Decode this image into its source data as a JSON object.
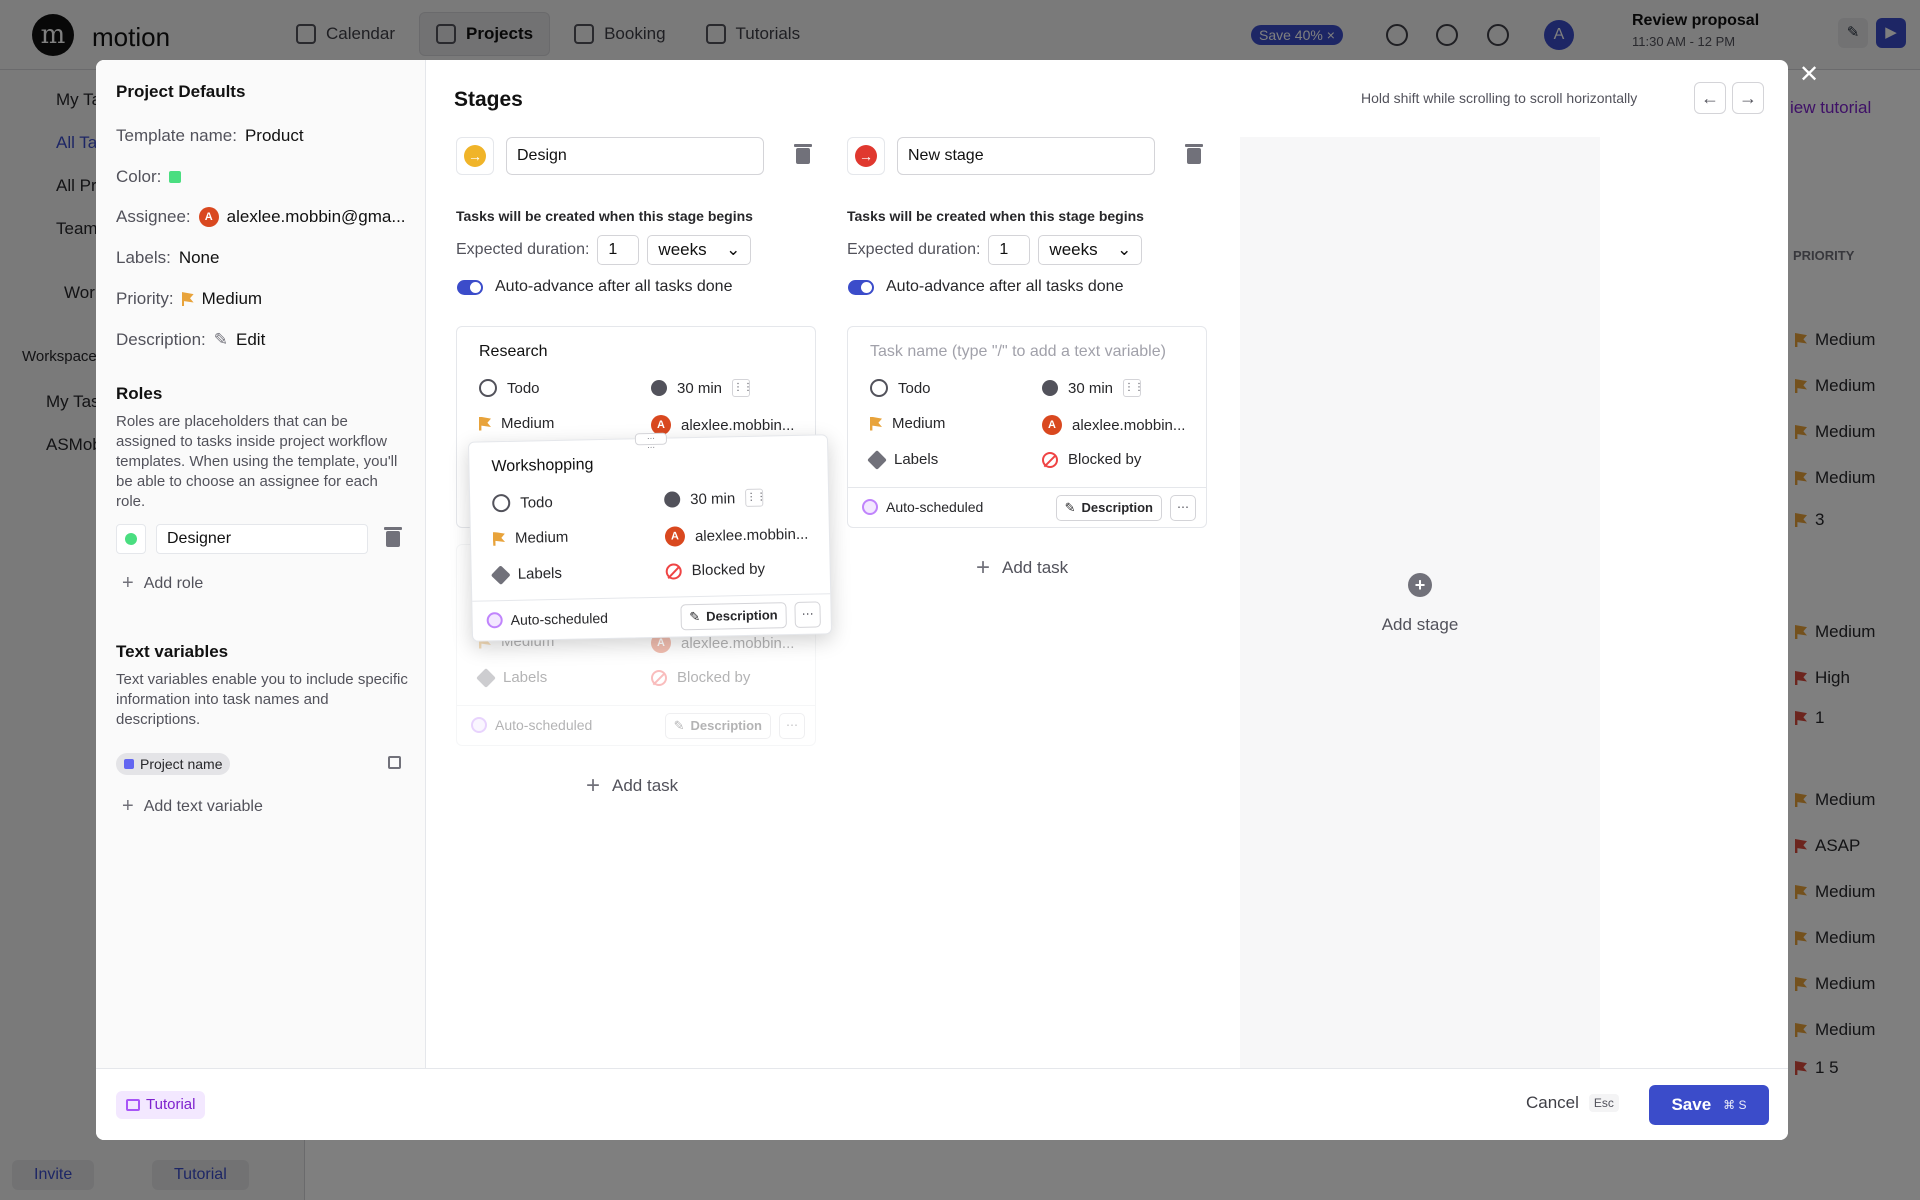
{
  "app": {
    "logo_letter": "m",
    "name": "motion",
    "nav": [
      "Calendar",
      "Projects",
      "Booking",
      "Tutorials"
    ],
    "save_badge": "Save 40%",
    "avatar_letter": "A",
    "review": {
      "title": "Review proposal",
      "time": "11:30 AM - 12 PM"
    },
    "sidebar": {
      "items": [
        "My Ta",
        "All Ta",
        "All Pr",
        "Team",
        "Wor",
        "Workspace",
        "My Tas",
        "ASMob"
      ],
      "invite": "Invite",
      "tutorial": "Tutorial"
    },
    "view_tutorial": "iew tutorial",
    "priority_header": "PRIORITY",
    "priority_rows": [
      {
        "label": "Medium",
        "color": "#e8a33b"
      },
      {
        "label": "Medium",
        "color": "#e8a33b"
      },
      {
        "label": "Medium",
        "color": "#e8a33b"
      },
      {
        "label": "Medium",
        "color": "#e8a33b"
      },
      {
        "label": "3",
        "color": "#e8a33b"
      },
      {
        "label": "Medium",
        "color": "#e8a33b"
      },
      {
        "label": "High",
        "color": "#d94a3c"
      },
      {
        "label": "1",
        "color": "#d94a3c"
      },
      {
        "label": "Medium",
        "color": "#e8a33b"
      },
      {
        "label": "ASAP",
        "color": "#d94a3c"
      },
      {
        "label": "Medium",
        "color": "#e8a33b"
      },
      {
        "label": "Medium",
        "color": "#e8a33b"
      },
      {
        "label": "Medium",
        "color": "#e8a33b"
      },
      {
        "label": "Medium",
        "color": "#e8a33b"
      },
      {
        "label": "1   5",
        "color": "#d94a3c"
      }
    ]
  },
  "defaults": {
    "title": "Project Defaults",
    "template_label": "Template name:",
    "template_value": "Product",
    "color_label": "Color:",
    "color_value": "#4ade80",
    "assignee_label": "Assignee:",
    "assignee_value": "alexlee.mobbin@gma...",
    "labels_label": "Labels:",
    "labels_value": "None",
    "priority_label": "Priority:",
    "priority_value": "Medium",
    "description_label": "Description:",
    "description_value": "Edit"
  },
  "roles": {
    "title": "Roles",
    "text": "Roles are placeholders that can be assigned to tasks inside project workflow templates. When using the template, you'll be able to choose an assignee for each role.",
    "role_value": "Designer",
    "add_label": "Add role"
  },
  "variables": {
    "title": "Text variables",
    "text": "Text variables enable you to include specific information into task names and descriptions.",
    "chip": "Project name",
    "add_label": "Add text variable"
  },
  "stages": {
    "title": "Stages",
    "scroll_hint": "Hold shift while scrolling to scroll horizontally",
    "note": "Tasks will be created when this stage begins",
    "duration_label": "Expected duration:",
    "auto_advance": "Auto-advance after all tasks done",
    "add_task": "Add task",
    "add_stage": "Add stage",
    "list": [
      {
        "name": "Design",
        "color": "#f0b429",
        "duration": "1",
        "unit": "weeks"
      },
      {
        "name": "New stage",
        "color": "#e0382f",
        "duration": "1",
        "unit": "weeks"
      }
    ]
  },
  "task": {
    "status": "Todo",
    "duration": "30 min",
    "priority": "Medium",
    "assignee": "alexlee.mobbin...",
    "labels": "Labels",
    "blocked": "Blocked by",
    "auto": "Auto-scheduled",
    "description": "Description",
    "placeholder": "Task name (type \"/\" to add a text variable)",
    "research": "Research",
    "workshopping": "Workshopping"
  },
  "footer": {
    "tutorial": "Tutorial",
    "cancel": "Cancel",
    "cancel_key": "Esc",
    "save": "Save",
    "save_key": "⌘ S"
  }
}
